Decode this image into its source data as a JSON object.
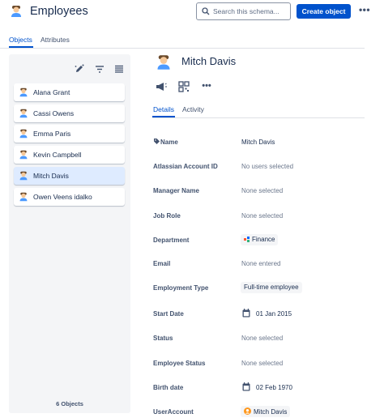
{
  "header": {
    "title": "Employees",
    "icon": "person-avatar-icon",
    "search_placeholder": "Search this schema...",
    "create_label": "Create object",
    "more_icon": "more-horizontal-icon"
  },
  "top_tabs": [
    {
      "label": "Objects",
      "active": true
    },
    {
      "label": "Attributes",
      "active": false
    }
  ],
  "sidebar": {
    "tools": [
      "edit-icon",
      "filter-icon",
      "list-view-icon"
    ],
    "items": [
      {
        "label": "Alana Grant",
        "selected": false
      },
      {
        "label": "Cassi Owens",
        "selected": false
      },
      {
        "label": "Emma Paris",
        "selected": false
      },
      {
        "label": "Kevin Campbell",
        "selected": false
      },
      {
        "label": "Mitch Davis",
        "selected": true
      },
      {
        "label": "Owen Veens idalko",
        "selected": false
      }
    ],
    "count_label": "6 Objects"
  },
  "detail": {
    "name": "Mitch Davis",
    "actions": [
      "megaphone-icon",
      "qr-code-icon",
      "more-horizontal-icon"
    ],
    "tabs": [
      {
        "label": "Details",
        "active": true
      },
      {
        "label": "Activity",
        "active": false
      }
    ],
    "attributes": [
      {
        "label": "Name",
        "value": "Mitch Davis",
        "label_icon": "tag-icon"
      },
      {
        "label": "Atlassian Account ID",
        "value": "No users selected"
      },
      {
        "label": "Manager Name",
        "value": "None selected"
      },
      {
        "label": "Job Role",
        "value": "None selected"
      },
      {
        "label": "Department",
        "value": "Finance",
        "value_icon": "department-icon"
      },
      {
        "label": "Email",
        "value": "None entered"
      },
      {
        "label": "Employment Type",
        "value": "Full-time employee"
      },
      {
        "label": "Start Date",
        "value": "01 Jan 2015",
        "value_icon": "calendar-icon"
      },
      {
        "label": "Status",
        "value": "None selected"
      },
      {
        "label": "Employee Status",
        "value": "None selected"
      },
      {
        "label": "Birth date",
        "value": "02 Feb 1970",
        "value_icon": "calendar-icon"
      },
      {
        "label": "UserAccount",
        "value": "Mitch Davis",
        "value_icon": "user-avatar-icon"
      }
    ]
  },
  "colors": {
    "primary": "#0052cc",
    "sidebar_bg": "#f4f5f7",
    "selected_bg": "#deebff",
    "text": "#172b4d",
    "subtle_text": "#6b778c"
  }
}
